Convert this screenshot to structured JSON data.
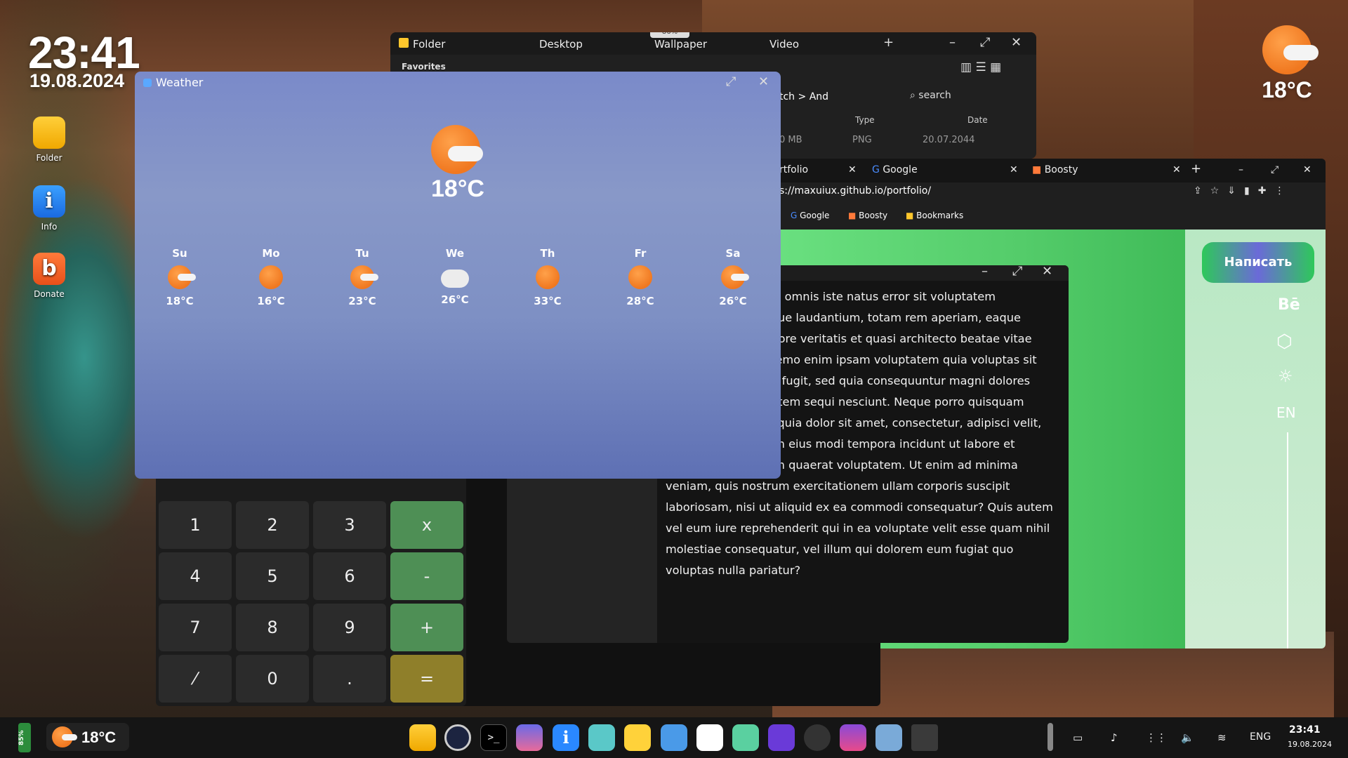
{
  "desktop": {
    "time": "23:41",
    "date": "19.08.2024",
    "icons": [
      {
        "label": "Folder"
      },
      {
        "label": "Info"
      },
      {
        "label": "Donate"
      }
    ],
    "weather_widget_temp": "18°C"
  },
  "file_manager": {
    "tabs": [
      "Folder",
      "Desktop",
      "Wallpaper",
      "Video"
    ],
    "favorites": "Favorites",
    "path": "tch > And",
    "search_placeholder": "search",
    "columns": [
      "Type",
      "Date"
    ],
    "row": {
      "size": "0 MB",
      "type": "PNG",
      "date": "20.07.2044"
    },
    "badge": "86%"
  },
  "browser": {
    "tabs": [
      "rtfolio",
      "Google",
      "Boosty"
    ],
    "url": "s://maxuiux.github.io/portfolio/",
    "bookmarks": [
      "Google",
      "Boosty",
      "Bookmarks"
    ],
    "write_button": "Написать",
    "side_labels": {
      "behance": "Bē",
      "lang": "EN"
    }
  },
  "text_window": {
    "lines": [
      "nde omnis iste natus error sit voluptatem",
      "mque laudantium, totam rem aperiam, eaque",
      "entore veritatis et quasi architecto beatae vitae",
      ". Nemo enim ipsam voluptatem quia voluptas sit",
      "aut fugit, sed quia consequuntur magni dolores",
      "otatem sequi nesciunt. Neque porro quisquam",
      "im quia dolor sit amet, consectetur, adipisci velit,",
      "uam eius modi tempora incidunt ut labore et",
      "uam quaerat voluptatem. Ut enim ad minima",
      "veniam, quis nostrum exercitationem ullam corporis suscipit",
      "laboriosam, nisi ut aliquid ex ea commodi consequatur? Quis autem",
      "vel eum iure reprehenderit qui in ea voluptate velit esse quam nihil",
      "molestiae consequatur, vel illum qui dolorem eum fugiat quo",
      "voluptas nulla pariatur?"
    ]
  },
  "calculator": {
    "keys": [
      [
        "1",
        "2",
        "3",
        "x"
      ],
      [
        "4",
        "5",
        "6",
        "-"
      ],
      [
        "7",
        "8",
        "9",
        "+"
      ],
      [
        "⁄",
        "0",
        ".",
        "="
      ]
    ]
  },
  "weather": {
    "title": "Weather",
    "current_temp": "18°C",
    "days": [
      {
        "name": "Su",
        "temp": "18°C",
        "icon": "sun-cloud"
      },
      {
        "name": "Mo",
        "temp": "16°C",
        "icon": "sun"
      },
      {
        "name": "Tu",
        "temp": "23°C",
        "icon": "sun-cloud"
      },
      {
        "name": "We",
        "temp": "26°C",
        "icon": "cloud"
      },
      {
        "name": "Th",
        "temp": "33°C",
        "icon": "sun"
      },
      {
        "name": "Fr",
        "temp": "28°C",
        "icon": "sun"
      },
      {
        "name": "Sa",
        "temp": "26°C",
        "icon": "sun-cloud"
      }
    ]
  },
  "taskbar": {
    "battery": "85%",
    "weather_temp": "18°C",
    "lang": "ENG",
    "time": "23:41",
    "date": "19.08.2024"
  }
}
